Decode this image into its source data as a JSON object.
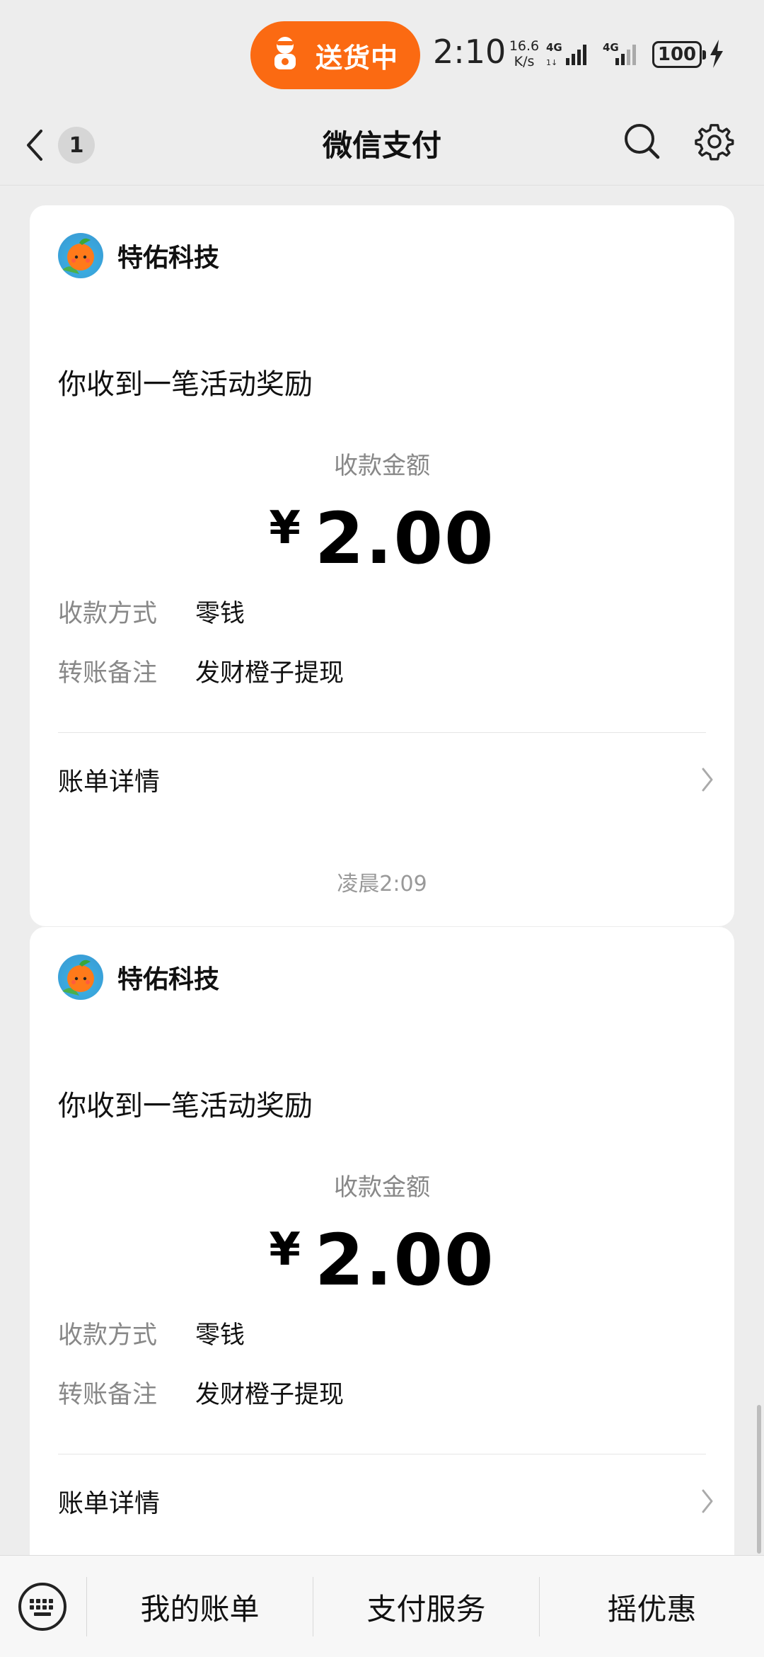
{
  "status_bar": {
    "delivery_label": "送货中",
    "time": "2:10",
    "net_speed_value": "16.6",
    "net_speed_unit": "K/s",
    "signal_1": "4G",
    "signal_2": "4G",
    "battery": "100",
    "pill_color": "#fb6a12"
  },
  "nav": {
    "back_badge": "1",
    "title": "微信支付",
    "icons": [
      "chevron-left-icon",
      "search-icon",
      "gear-icon"
    ]
  },
  "cards": [
    {
      "merchant": "特佑科技",
      "headline": "你收到一笔活动奖励",
      "amount_label": "收款金额",
      "currency": "¥",
      "amount": "2.00",
      "method_key": "收款方式",
      "method_value": "零钱",
      "note_key": "转账备注",
      "note_value": "发财橙子提现",
      "detail_label": "账单详情"
    },
    {
      "merchant": "特佑科技",
      "headline": "你收到一笔活动奖励",
      "amount_label": "收款金额",
      "currency": "¥",
      "amount": "2.00",
      "method_key": "收款方式",
      "method_value": "零钱",
      "note_key": "转账备注",
      "note_value": "发财橙子提现",
      "detail_label": "账单详情"
    }
  ],
  "timestamp": "凌晨2:09",
  "bottom_bar": {
    "items": [
      "我的账单",
      "支付服务",
      "摇优惠"
    ],
    "keyboard_icon": "keyboard-icon"
  }
}
